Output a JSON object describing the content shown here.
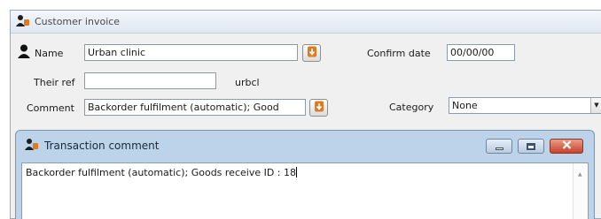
{
  "main_window": {
    "title": "Customer invoice",
    "name_label": "Name",
    "name_value": "Urban clinic",
    "their_ref_label": "Their ref",
    "their_ref_value": "",
    "customer_code": "urbcl",
    "comment_label": "Comment",
    "comment_value": "Backorder fulfilment (automatic);  Good",
    "confirm_date_label": "Confirm date",
    "confirm_date_value": "00/00/00",
    "category_label": "Category",
    "category_value": "None"
  },
  "dialog": {
    "title": "Transaction comment",
    "text": "Backorder fulfilment (automatic);  Goods receive ID : 18"
  },
  "colors": {
    "accent_orange": "#e07a1f",
    "dialog_frame": "#bcd3ea",
    "close_button": "#c8432b"
  },
  "icons": [
    "app-icon",
    "person-icon",
    "pick-arrow-icon",
    "minimize-icon",
    "maximize-icon",
    "close-icon",
    "scroll-up-icon",
    "dropdown-arrow-icon"
  ]
}
